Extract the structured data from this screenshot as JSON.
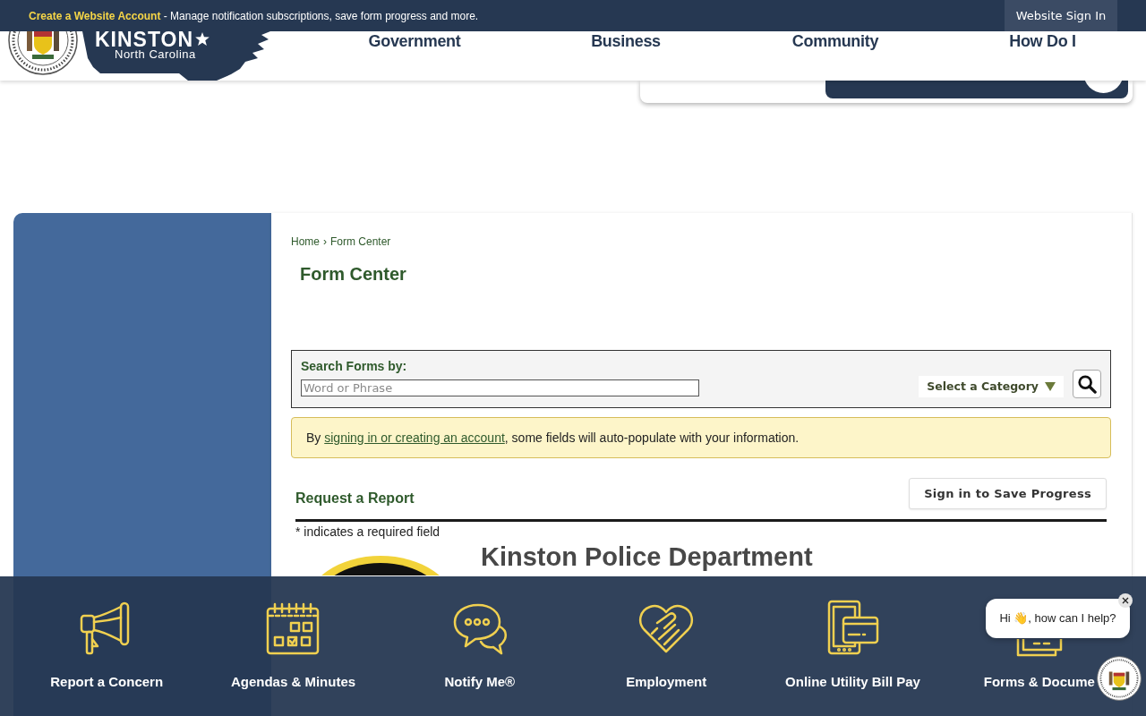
{
  "top_bar": {
    "account_link": "Create a Website Account",
    "message": "- Manage notification subscriptions, save form progress and more.",
    "sign_in_button": "Website Sign In"
  },
  "logo": {
    "name": "KINSTON",
    "subtitle": "North Carolina"
  },
  "nav": [
    "Government",
    "Business",
    "Community",
    "How Do I"
  ],
  "breadcrumb": {
    "items": [
      "Home",
      "Form Center"
    ],
    "separator": "›"
  },
  "page_title": "Form Center",
  "search": {
    "label": "Search Forms by:",
    "placeholder": "Word or Phrase",
    "category_select": "Select a Category"
  },
  "notice": {
    "before": "By ",
    "link": "signing in or creating an account",
    "after": ", some fields will auto-populate with your information."
  },
  "form": {
    "title": "Request a Report",
    "save_button": "Sign in to Save Progress",
    "required_note": "* indicates a required field",
    "heading": "Kinston Police Department"
  },
  "quick_links": [
    {
      "label": "Report a Concern"
    },
    {
      "label": "Agendas & Minutes"
    },
    {
      "label": "Notify Me®"
    },
    {
      "label": "Employment"
    },
    {
      "label": "Online Utility Bill Pay"
    },
    {
      "label": "Forms & Docume"
    }
  ],
  "chat": {
    "greeting": "Hi 👋, how can I help?"
  }
}
